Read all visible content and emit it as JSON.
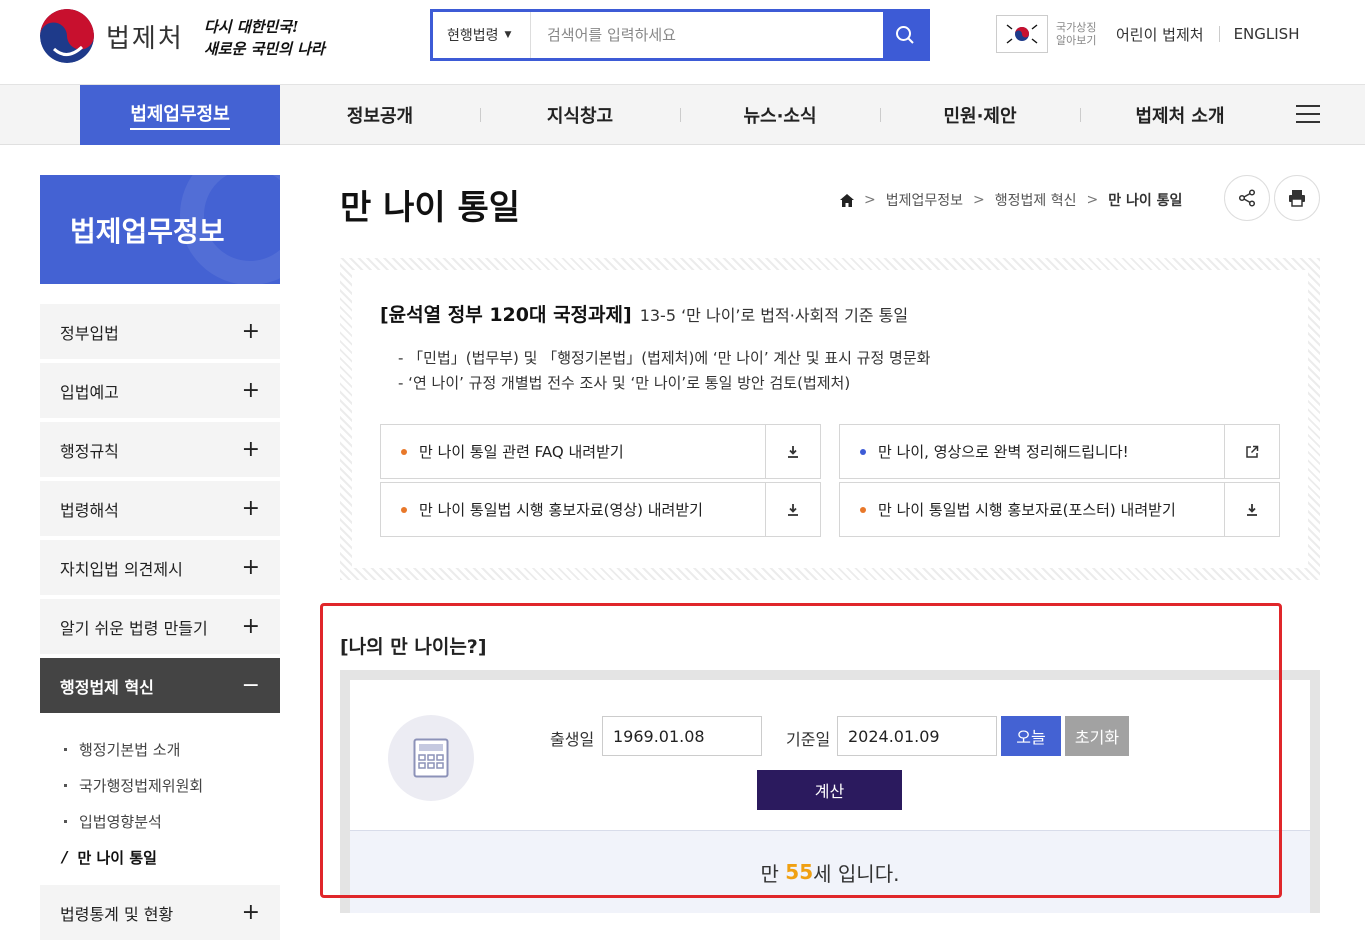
{
  "header": {
    "logo_text": "법제처",
    "slogan_line1": "다시 대한민국!",
    "slogan_line2": "새로운 국민의 나라",
    "search_select": "현행법령",
    "search_placeholder": "검색어를 입력하세요",
    "flag_text": "국가상징 알아보기",
    "kids_link": "어린이 법제처",
    "english_link": "ENGLISH"
  },
  "gnb": {
    "items": [
      "법제업무정보",
      "정보공개",
      "지식창고",
      "뉴스·소식",
      "민원·제안",
      "법제처 소개"
    ]
  },
  "sidebar": {
    "title": "법제업무정보",
    "items": [
      "정부입법",
      "입법예고",
      "행정규칙",
      "법령해석",
      "자치입법 의견제시",
      "알기 쉬운 법령 만들기",
      "행정법제 혁신",
      "법령통계 및 현황"
    ],
    "plus": "+",
    "minus": "−",
    "sub_items": [
      "행정기본법 소개",
      "국가행정법제위원회",
      "입법영향분석",
      "만 나이 통일"
    ]
  },
  "page": {
    "title": "만 나이 통일",
    "breadcrumb": [
      "법제업무정보",
      "행정법제 혁신",
      "만 나이 통일"
    ]
  },
  "info": {
    "head_bold": "[윤석열 정부 120대 국정과제]",
    "head_rest": "13-5 ‘만 나이’로 법적·사회적 기준 통일",
    "line1": "- 「민법」(법무부) 및 「행정기본법」(법제처)에 ‘만 나이’ 계산 및 표시 규정 명문화",
    "line2": "- ‘연 나이’ 규정 개별법 전수 조사 및 ‘만 나이’로 통일 방안 검토(법제처)",
    "buttons": [
      "만 나이 통일 관련 FAQ 내려받기",
      "만 나이, 영상으로 완벽 정리해드립니다!",
      "만 나이 통일법 시행 홍보자료(영상) 내려받기",
      "만 나이 통일법 시행 홍보자료(포스터) 내려받기"
    ]
  },
  "calculator": {
    "title": "[나의 만 나이는?]",
    "birth_label": "출생일",
    "birth_value": "1969.01.08",
    "base_label": "기준일",
    "base_value": "2024.01.09",
    "today_btn": "오늘",
    "reset_btn": "초기화",
    "calc_btn": "계산",
    "result_prefix": "만 ",
    "result_age": "55",
    "result_suffix": "세 입니다."
  },
  "colors": {
    "primary": "#4462d3",
    "calc_button": "#2b1a5e",
    "highlight": "#e0262a",
    "result_age": "#f0a012"
  }
}
